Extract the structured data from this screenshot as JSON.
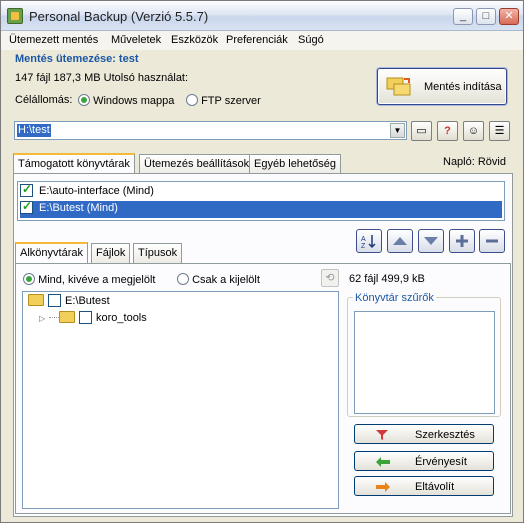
{
  "window": {
    "title": "Personal Backup (Verzió 5.5.7)",
    "controls": {
      "minimize": "_",
      "maximize": "□",
      "close": "✕"
    }
  },
  "menu": [
    "Ütemezett mentés",
    "Műveletek",
    "Eszközök",
    "Preferenciák",
    "Súgó"
  ],
  "schedule": {
    "title": "Mentés ütemezése: test",
    "info": "147 fájl 187,3 MB  Utolsó használat:",
    "destination_label": "Célállomás:",
    "dest_options": [
      "Windows mappa",
      "FTP szerver"
    ],
    "dest_selected": "Windows mappa",
    "start_button": "Mentés indítása"
  },
  "path": {
    "value": "H:\\test"
  },
  "tabs": [
    "Támogatott könyvtárak",
    "Ütemezés beállítások",
    "Egyéb lehetőség"
  ],
  "log_label": "Napló: Rövid",
  "directories": [
    {
      "label": "E:\\auto-interface (Mind)",
      "checked": true,
      "selected": false
    },
    {
      "label": "E:\\Butest (Mind)",
      "checked": true,
      "selected": true
    }
  ],
  "subtabs": [
    "Alkönyvtárak",
    "Fájlok",
    "Típusok"
  ],
  "sub_options": [
    "Mind, kivéve a megjelölt",
    "Csak a kijelölt"
  ],
  "sub_selected": "Mind, kivéve a megjelölt",
  "tree": [
    {
      "label": "E:\\Butest",
      "level": 0
    },
    {
      "label": "koro_tools",
      "level": 1
    }
  ],
  "stats": "62 fájl 499,9 kB",
  "filter": {
    "title": "Könyvtár szűrők",
    "buttons": [
      "Szerkesztés",
      "Érvényesít",
      "Eltávolít"
    ]
  },
  "icons": {
    "accent": "#1c57a5",
    "selection": "#316ac5"
  }
}
